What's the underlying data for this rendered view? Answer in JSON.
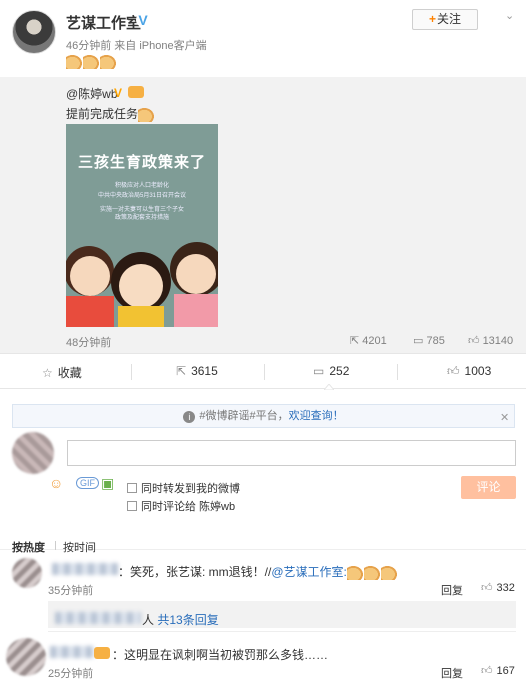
{
  "post": {
    "author": "艺谋工作室",
    "verified_mark": "V",
    "meta": "46分钟前 来自 iPhone客户端",
    "emoji_icons": [
      "muscle-emoji",
      "muscle-emoji",
      "muscle-emoji"
    ],
    "follow_label": "关注",
    "follow_plus": "+"
  },
  "repost": {
    "name": "@陈婷wb",
    "vip_mark": "V",
    "text": "提前完成任务",
    "poster": {
      "title": "三孩生育政策来了",
      "lines": [
        "积极应对人口老龄化",
        "中共中央政治局5月31日召开会议",
        "实施一对夫妻可以生育三个子女",
        "政策及配套支持措施"
      ]
    },
    "time": "48分钟前",
    "stats": {
      "reposts": "4201",
      "comments": "785",
      "likes": "13140"
    }
  },
  "actions": {
    "favorite": "收藏",
    "repost": "3615",
    "comment": "252",
    "like": "1003"
  },
  "notice": {
    "prefix": "#微博辟谣#平台，",
    "link": "欢迎查询！",
    "close": "✕"
  },
  "compose": {
    "placeholder": "",
    "repost_option": "同时转发到我的微博",
    "comment_to_option": "同时评论给 陈婷wb",
    "submit": "评论"
  },
  "sort": {
    "hot": "按热度",
    "time": "按时间"
  },
  "comments": [
    {
      "text_prefix": "：笑死，张艺谋: mm退钱！//",
      "mention": "@艺谋工作室:",
      "time": "35分钟前",
      "reply": "回复",
      "likes": "332",
      "sub_more_suffix": "人",
      "sub_more_link": "共13条回复"
    },
    {
      "text": "：这明显在讽刺啊当初被罚那么多钱……",
      "time": "25分钟前",
      "reply": "回复",
      "likes": "167"
    }
  ]
}
